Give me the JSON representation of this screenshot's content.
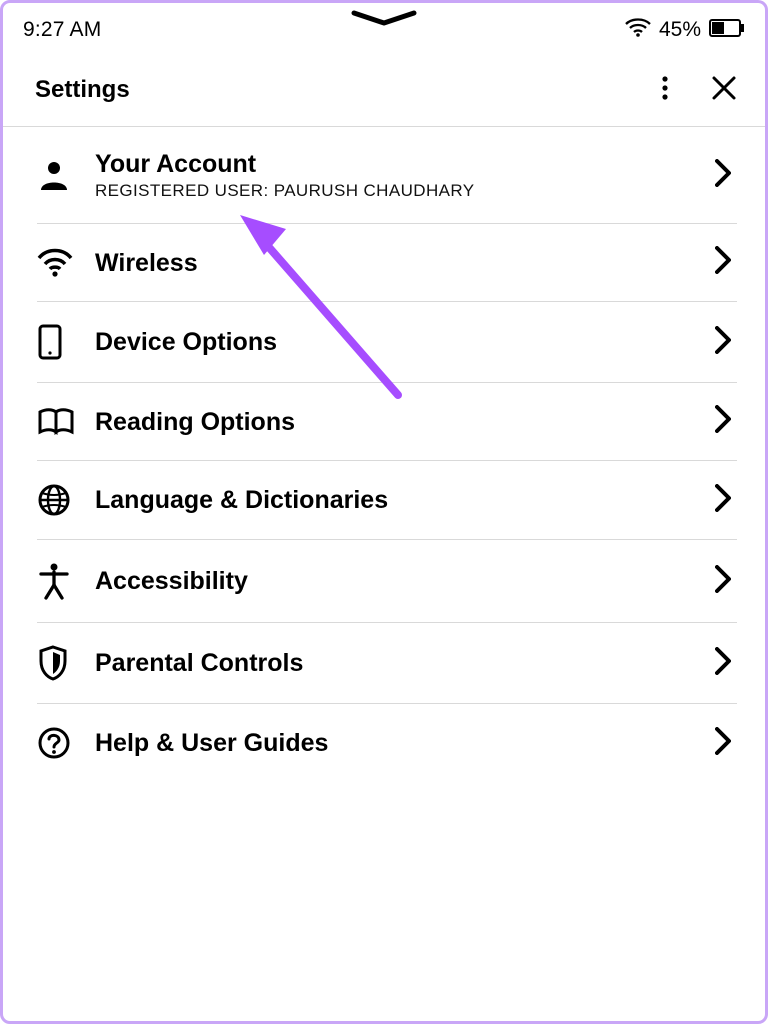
{
  "statusbar": {
    "time": "9:27 AM",
    "battery_pct": "45%"
  },
  "header": {
    "title": "Settings"
  },
  "rows": [
    {
      "icon": "person",
      "title": "Your Account",
      "subtitle": "REGISTERED USER: PAURUSH CHAUDHARY"
    },
    {
      "icon": "wifi",
      "title": "Wireless"
    },
    {
      "icon": "device",
      "title": "Device Options"
    },
    {
      "icon": "book",
      "title": "Reading Options"
    },
    {
      "icon": "globe",
      "title": "Language & Dictionaries"
    },
    {
      "icon": "accessibility",
      "title": "Accessibility"
    },
    {
      "icon": "shield",
      "title": "Parental Controls"
    },
    {
      "icon": "help",
      "title": "Help & User Guides"
    }
  ]
}
